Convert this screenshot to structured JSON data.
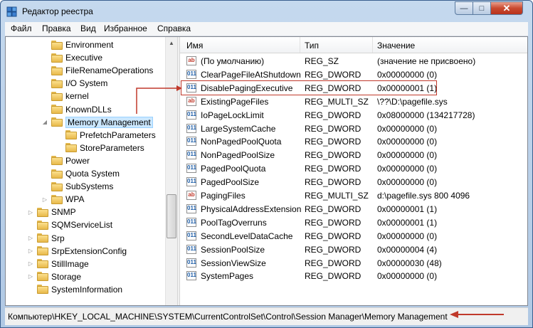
{
  "window": {
    "title": "Редактор реестра"
  },
  "titlebar_buttons": {
    "minimize": "—",
    "maximize": "□",
    "close": "✕"
  },
  "menu": [
    "Файл",
    "Правка",
    "Вид",
    "Избранное",
    "Справка"
  ],
  "tree": [
    {
      "label": "Environment",
      "level": 1,
      "expander": ""
    },
    {
      "label": "Executive",
      "level": 1,
      "expander": ""
    },
    {
      "label": "FileRenameOperations",
      "level": 1,
      "expander": ""
    },
    {
      "label": "I/O System",
      "level": 1,
      "expander": ""
    },
    {
      "label": "kernel",
      "level": 1,
      "expander": ""
    },
    {
      "label": "KnownDLLs",
      "level": 1,
      "expander": ""
    },
    {
      "label": "Memory Management",
      "level": 1,
      "expander": "expanded",
      "selected": true
    },
    {
      "label": "PrefetchParameters",
      "level": 2,
      "expander": ""
    },
    {
      "label": "StoreParameters",
      "level": 2,
      "expander": ""
    },
    {
      "label": "Power",
      "level": 1,
      "expander": ""
    },
    {
      "label": "Quota System",
      "level": 1,
      "expander": ""
    },
    {
      "label": "SubSystems",
      "level": 1,
      "expander": ""
    },
    {
      "label": "WPA",
      "level": 1,
      "expander": "collapsed"
    },
    {
      "label": "SNMP",
      "level": 0,
      "expander": "collapsed"
    },
    {
      "label": "SQMServiceList",
      "level": 0,
      "expander": ""
    },
    {
      "label": "Srp",
      "level": 0,
      "expander": "collapsed"
    },
    {
      "label": "SrpExtensionConfig",
      "level": 0,
      "expander": "collapsed"
    },
    {
      "label": "StillImage",
      "level": 0,
      "expander": "collapsed"
    },
    {
      "label": "Storage",
      "level": 0,
      "expander": "collapsed"
    },
    {
      "label": "SystemInformation",
      "level": 0,
      "expander": ""
    }
  ],
  "columns": {
    "name": "Имя",
    "type": "Тип",
    "data": "Значение"
  },
  "values": [
    {
      "icon": "ab",
      "name": "(По умолчанию)",
      "type": "REG_SZ",
      "data": "(значение не присвоено)"
    },
    {
      "icon": "011",
      "name": "ClearPageFileAtShutdown",
      "type": "REG_DWORD",
      "data": "0x00000000 (0)"
    },
    {
      "icon": "011",
      "name": "DisablePagingExecutive",
      "type": "REG_DWORD",
      "data": "0x00000001 (1)",
      "highlight": true
    },
    {
      "icon": "ab",
      "name": "ExistingPageFiles",
      "type": "REG_MULTI_SZ",
      "data": "\\??\\D:\\pagefile.sys"
    },
    {
      "icon": "011",
      "name": "IoPageLockLimit",
      "type": "REG_DWORD",
      "data": "0x08000000 (134217728)"
    },
    {
      "icon": "011",
      "name": "LargeSystemCache",
      "type": "REG_DWORD",
      "data": "0x00000000 (0)"
    },
    {
      "icon": "011",
      "name": "NonPagedPoolQuota",
      "type": "REG_DWORD",
      "data": "0x00000000 (0)"
    },
    {
      "icon": "011",
      "name": "NonPagedPoolSize",
      "type": "REG_DWORD",
      "data": "0x00000000 (0)"
    },
    {
      "icon": "011",
      "name": "PagedPoolQuota",
      "type": "REG_DWORD",
      "data": "0x00000000 (0)"
    },
    {
      "icon": "011",
      "name": "PagedPoolSize",
      "type": "REG_DWORD",
      "data": "0x00000000 (0)"
    },
    {
      "icon": "ab",
      "name": "PagingFiles",
      "type": "REG_MULTI_SZ",
      "data": "d:\\pagefile.sys 800 4096"
    },
    {
      "icon": "011",
      "name": "PhysicalAddressExtension",
      "type": "REG_DWORD",
      "data": "0x00000001 (1)"
    },
    {
      "icon": "011",
      "name": "PoolTagOverruns",
      "type": "REG_DWORD",
      "data": "0x00000001 (1)"
    },
    {
      "icon": "011",
      "name": "SecondLevelDataCache",
      "type": "REG_DWORD",
      "data": "0x00000000 (0)"
    },
    {
      "icon": "011",
      "name": "SessionPoolSize",
      "type": "REG_DWORD",
      "data": "0x00000004 (4)"
    },
    {
      "icon": "011",
      "name": "SessionViewSize",
      "type": "REG_DWORD",
      "data": "0x00000030 (48)"
    },
    {
      "icon": "011",
      "name": "SystemPages",
      "type": "REG_DWORD",
      "data": "0x00000000 (0)"
    }
  ],
  "status": "Компьютер\\HKEY_LOCAL_MACHINE\\SYSTEM\\CurrentControlSet\\Control\\Session Manager\\Memory Management",
  "colors": {
    "annotation": "#c0392b",
    "selection": "#cce8ff"
  }
}
